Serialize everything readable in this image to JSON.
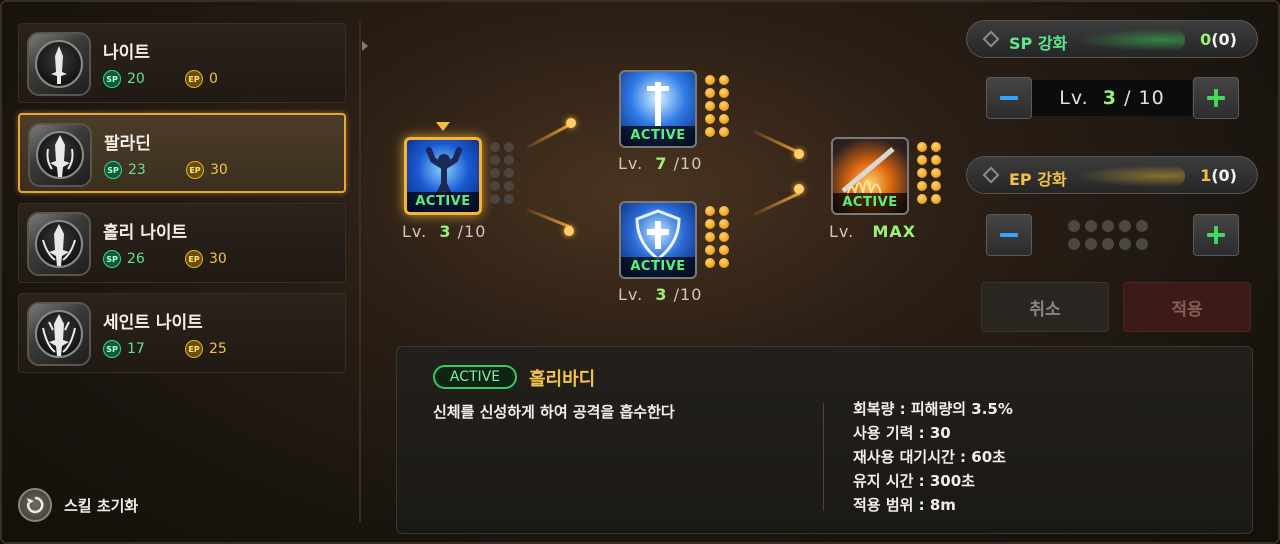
{
  "classes": [
    {
      "name": "나이트",
      "sp": "20",
      "ep": "0"
    },
    {
      "name": "팔라딘",
      "sp": "23",
      "ep": "30"
    },
    {
      "name": "홀리 나이트",
      "sp": "26",
      "ep": "30"
    },
    {
      "name": "세인트 나이트",
      "sp": "17",
      "ep": "25"
    }
  ],
  "badges": {
    "sp": "SP",
    "ep": "EP"
  },
  "reset_label": "스킬 초기화",
  "skills": {
    "active_label": "ACTIVE",
    "lv_prefix": "Lv.",
    "slash": "/",
    "s1": {
      "cur": "3",
      "max": "10"
    },
    "s2": {
      "cur": "7",
      "max": "10"
    },
    "s3": {
      "cur": "3",
      "max": "10"
    },
    "s4": {
      "max_label": "MAX"
    }
  },
  "right": {
    "sp_label": "SP 강화",
    "sp_value": "0",
    "sp_paren": "(0)",
    "ep_label": "EP 강화",
    "ep_value": "1",
    "ep_paren": "(0)",
    "lv_prefix": "Lv.",
    "lv_cur": "3",
    "lv_max": "10",
    "cancel": "취소",
    "apply": "적용",
    "colors": {
      "sp_accent": "#37e860",
      "ep_accent": "#f0c030",
      "selected_border": "#e6a63a"
    }
  },
  "description": {
    "tag": "ACTIVE",
    "title": "홀리바디",
    "text": "신체를 신성하게 하여 공격을 흡수한다",
    "stats": [
      "회복량 : 피해량의 3.5%",
      "사용 기력 : 30",
      "재사용 대기시간 : 60초",
      "유지 시간 : 300초",
      "적용 범위 : 8m"
    ]
  }
}
